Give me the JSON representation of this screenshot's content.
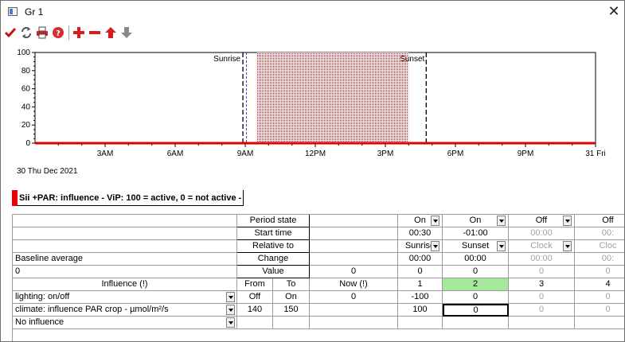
{
  "window": {
    "title": "Gr 1",
    "close_glyph": "✕"
  },
  "toolbar": {
    "icons": [
      "check-icon",
      "refresh-icon",
      "print-icon",
      "help-icon",
      "add-icon",
      "remove-icon",
      "move-up-icon",
      "move-down-icon"
    ]
  },
  "chart_data": {
    "type": "area",
    "y_ticks": [
      "100",
      "80",
      "60",
      "40",
      "20",
      "0"
    ],
    "ylim": [
      0,
      100
    ],
    "x_ticks": [
      "3AM",
      "6AM",
      "9AM",
      "12PM",
      "3PM",
      "6PM",
      "9PM",
      "31 Fri"
    ],
    "x_start_label": "30 Thu Dec 2021",
    "x_range_hours": [
      0,
      24
    ],
    "markers": [
      {
        "label": "Sunrise",
        "hour": 8.9
      },
      {
        "label": "Sunset",
        "hour": 16.75
      }
    ],
    "now_hour": 9.05,
    "series": [
      {
        "values_desc": "active period",
        "from_hour": 9.5,
        "to_hour": 16.0,
        "value": 100
      }
    ],
    "baseline_value": 0,
    "colors": {
      "series": "#dd0000",
      "fill": "#f4a0a0",
      "marker": "#000000",
      "now": "#3a4cd0"
    }
  },
  "influence_title": "Sii +PAR: influence - ViP: 100 = active, 0 = not active -",
  "grid": {
    "row_labels": {
      "period_state": "Period state",
      "start_time": "Start time",
      "relative_to": "Relative to",
      "change": "Change",
      "value": "Value"
    },
    "baseline_label": "Baseline average",
    "baseline_value": "0",
    "value_now": "0",
    "header": {
      "influence": "Influence (!)",
      "from": "From",
      "to": "To",
      "now": "Now (!)"
    },
    "periods": [
      {
        "number": "1",
        "state": "On",
        "start": "00:30",
        "relative": "Sunrise",
        "change": "00:00",
        "value": "0",
        "lighting": "-100",
        "climate": "100"
      },
      {
        "number": "2",
        "state": "On",
        "start": "-01:00",
        "relative": "Sunset",
        "change": "00:00",
        "value": "0",
        "lighting": "0",
        "climate": "0"
      },
      {
        "number": "3",
        "state": "Off",
        "start": "00:00",
        "relative": "Clock",
        "change": "00:00",
        "value": "0",
        "lighting": "0",
        "climate": "0"
      },
      {
        "number": "4",
        "state": "Off",
        "start": "00:",
        "relative": "Cloc",
        "change": "00:",
        "value": "0",
        "lighting": "0",
        "climate": "0"
      }
    ],
    "influences": [
      {
        "name": "lighting: on/off",
        "from": "Off",
        "to": "On",
        "now": "0"
      },
      {
        "name": "climate: influence PAR crop - µmol/m²/s",
        "from": "140",
        "to": "150",
        "now": ""
      },
      {
        "name": "No influence",
        "from": "",
        "to": "",
        "now": ""
      }
    ]
  }
}
